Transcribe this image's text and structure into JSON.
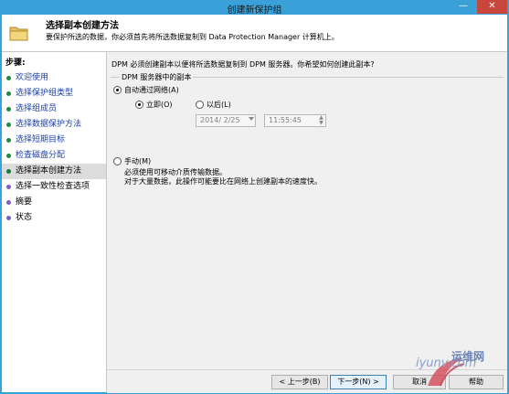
{
  "window": {
    "title": "创建新保护组",
    "minimize_glyph": "—",
    "close_glyph": "✕"
  },
  "header": {
    "title": "选择副本创建方法",
    "subtitle": "要保护所选的数据，你必须首先将所选数据复制到 Data Protection Manager 计算机上。"
  },
  "steps": {
    "heading": "步骤:",
    "items": [
      {
        "label": "欢迎使用",
        "state": "done"
      },
      {
        "label": "选择保护组类型",
        "state": "done"
      },
      {
        "label": "选择组成员",
        "state": "done"
      },
      {
        "label": "选择数据保护方法",
        "state": "done"
      },
      {
        "label": "选择短期目标",
        "state": "done"
      },
      {
        "label": "检查磁盘分配",
        "state": "done"
      },
      {
        "label": "选择副本创建方法",
        "state": "current"
      },
      {
        "label": "选择一致性检查选项",
        "state": "pending"
      },
      {
        "label": "摘要",
        "state": "pending"
      },
      {
        "label": "状态",
        "state": "pending"
      }
    ]
  },
  "main": {
    "question": "DPM 必须创建副本以便将所选数据复制到 DPM 服务器。你希望如何创建此副本?",
    "group_title": "DPM 服务器中的副本",
    "auto_label": "自动通过网络(A)",
    "auto_selected": true,
    "now_label": "立即(O)",
    "now_selected": true,
    "later_label": "以后(L)",
    "later_selected": false,
    "date_value": "2014/ 2/25",
    "time_value": "11:55:45",
    "manual_label": "手动(M)",
    "manual_selected": false,
    "manual_desc_1": "必须使用可移动介质传输数据。",
    "manual_desc_2": "对于大量数据，此操作可能要比在网络上创建副本的速度快。"
  },
  "footer": {
    "back_label": "< 上一步(B)",
    "next_label": "下一步(N) >",
    "cancel_label": "取消",
    "help_label": "帮助"
  },
  "watermark": {
    "text_a": "iyunv.com",
    "text_b": "运维网"
  },
  "colors": {
    "titlebar": "#3aa0d8",
    "close_button": "#c9463d",
    "step_done_text": "#1b3fa5",
    "step_done_dot": "#1a8c3a",
    "step_pending_dot": "#7a5cc3",
    "current_step_bg": "#dcdcdc"
  }
}
